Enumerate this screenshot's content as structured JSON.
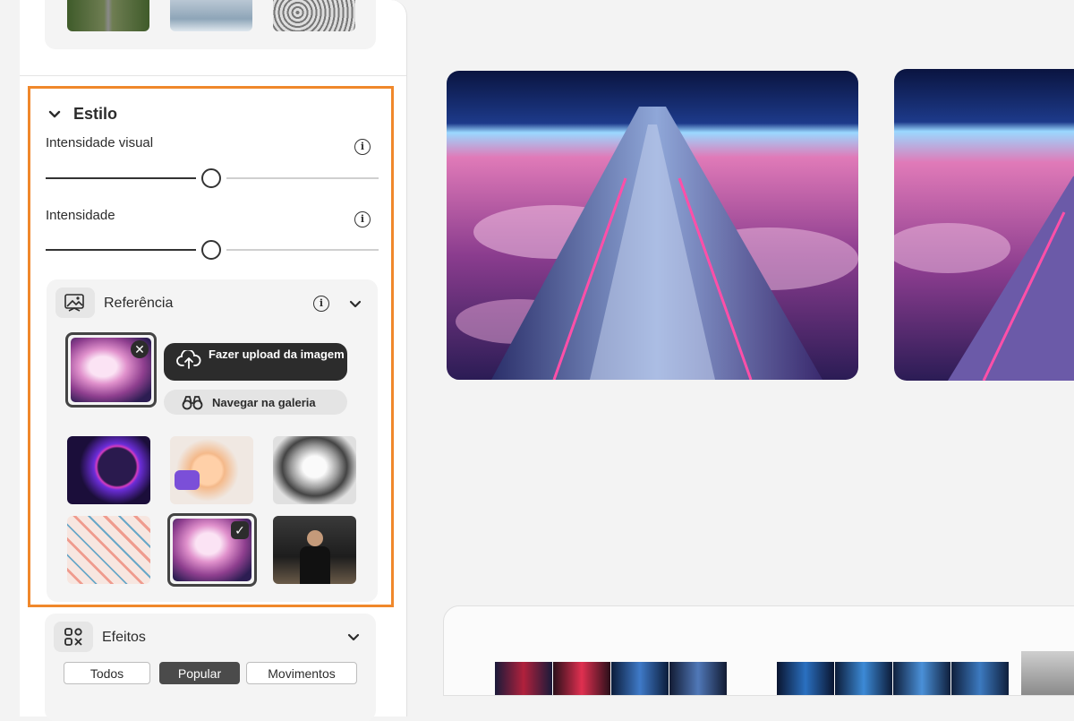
{
  "style_section": {
    "title": "Estilo",
    "visual_intensity": {
      "label": "Intensidade visual",
      "value": 0.5
    },
    "intensity": {
      "label": "Intensidade",
      "value": 0.5
    }
  },
  "reference": {
    "title": "Referência",
    "upload_label": "Fazer upload da imagem",
    "gallery_label": "Navegar na galeria",
    "selected_index": 4
  },
  "effects": {
    "title": "Efeitos",
    "chips": [
      "Todos",
      "Popular",
      "Movimentos"
    ],
    "active_chip": "Popular"
  },
  "colors": {
    "accent_border": "#f0882b",
    "dark_button": "#2c2c2c",
    "active_chip": "#4b4b4b"
  },
  "icons": {
    "style_chevron": "chevron-down-icon",
    "info": "info-icon",
    "reference": "image-reference-icon",
    "upload": "cloud-upload-icon",
    "gallery": "binoculars-icon",
    "remove": "close-icon",
    "check": "check-icon",
    "effects": "effects-icon"
  }
}
